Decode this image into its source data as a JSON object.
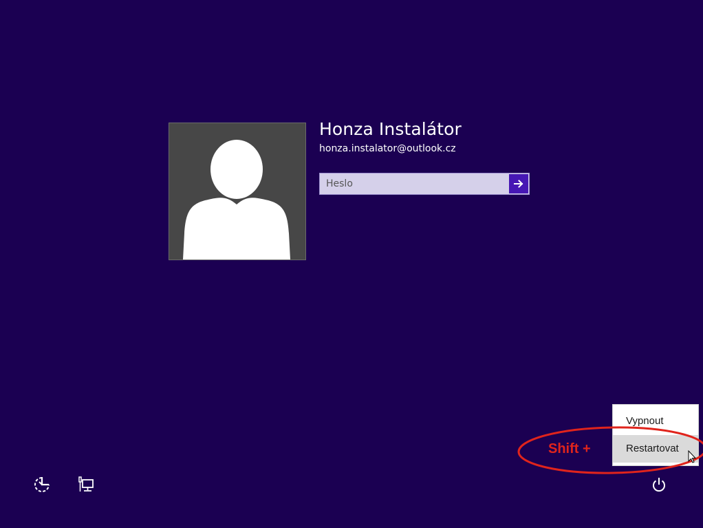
{
  "user": {
    "name": "Honza Instalátor",
    "email": "honza.instalator@outlook.cz"
  },
  "password": {
    "placeholder": "Heslo",
    "value": ""
  },
  "submit": {
    "icon": "arrow-right-icon"
  },
  "bottom_bar": {
    "ease_of_access_icon": "ease-of-access-icon",
    "network_icon": "network-icon",
    "power_icon": "power-icon"
  },
  "power_menu": {
    "items": [
      {
        "label": "Vypnout"
      },
      {
        "label": "Restartovat",
        "highlighted": true
      }
    ]
  },
  "annotation": {
    "text": "Shift +",
    "color": "#e0241c"
  },
  "colors": {
    "background": "#1b0052",
    "accent": "#4617b4",
    "avatar_bg": "#474747"
  }
}
